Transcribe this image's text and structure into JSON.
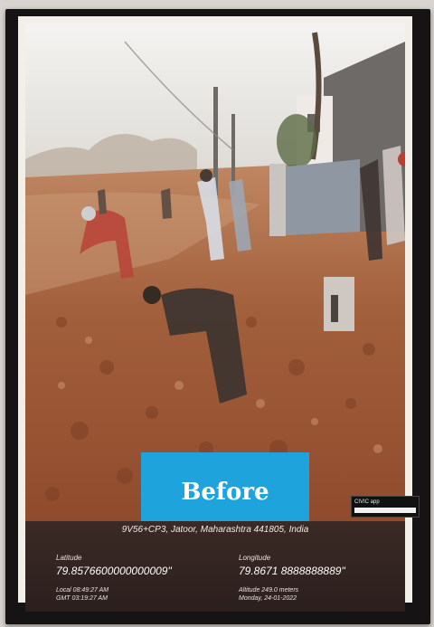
{
  "photo": {
    "badge_label": "Before",
    "logo_text": "CIVIC app",
    "address": "9V56+CP3, Jatoor, Maharashtra 441805, India",
    "latitude_label": "Latitude",
    "latitude_value": "79.8576600000000009\"",
    "longitude_label": "Longitude",
    "longitude_value": "79.8671 8888888889\"",
    "time_local": "Local 08:49:27 AM",
    "time_gmt": "GMT 03:19:27 AM",
    "altitude": "Altitude 249.0 meters",
    "date": "Monday, 24-01-2022"
  }
}
